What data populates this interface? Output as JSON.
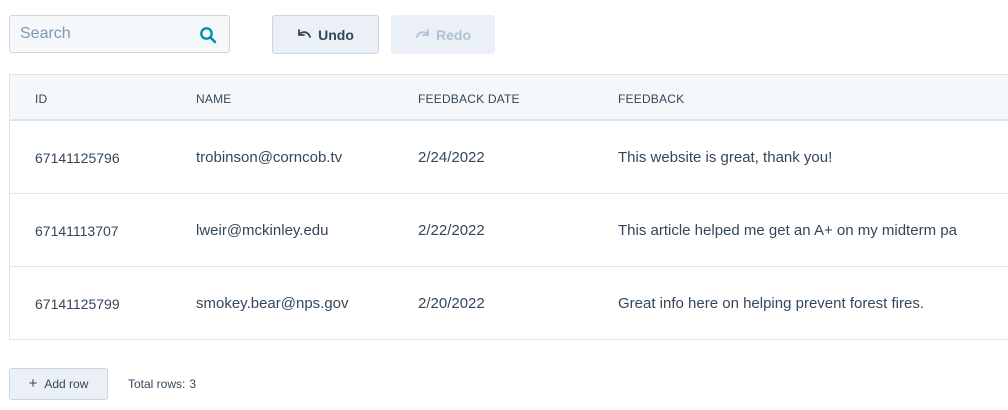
{
  "toolbar": {
    "search": {
      "placeholder": "Search",
      "value": ""
    },
    "undo_label": "Undo",
    "redo_label": "Redo",
    "icons": {
      "search": "search-icon",
      "undo": "undo-icon",
      "redo": "redo-icon"
    }
  },
  "table": {
    "columns": [
      "ID",
      "NAME",
      "FEEDBACK DATE",
      "FEEDBACK"
    ],
    "rows": [
      {
        "id": "67141125796",
        "name": "trobinson@corncob.tv",
        "date": "2/24/2022",
        "feedback": "This website is great, thank you!"
      },
      {
        "id": "67141113707",
        "name": "lweir@mckinley.edu",
        "date": "2/22/2022",
        "feedback": "This article helped me get an A+ on my midterm pa"
      },
      {
        "id": "67141125799",
        "name": "smokey.bear@nps.gov",
        "date": "2/20/2022",
        "feedback": "Great info here on helping prevent forest fires."
      }
    ]
  },
  "footer": {
    "add_row_label": "Add row",
    "total_label": "Total rows:",
    "total_count": "3"
  },
  "colors": {
    "text": "#33475b",
    "placeholder": "#7c98b6",
    "accent": "#0091ae",
    "disabled": "#b0c1d4",
    "border": "#dfe3eb",
    "header_bg": "#f5f8fa"
  }
}
